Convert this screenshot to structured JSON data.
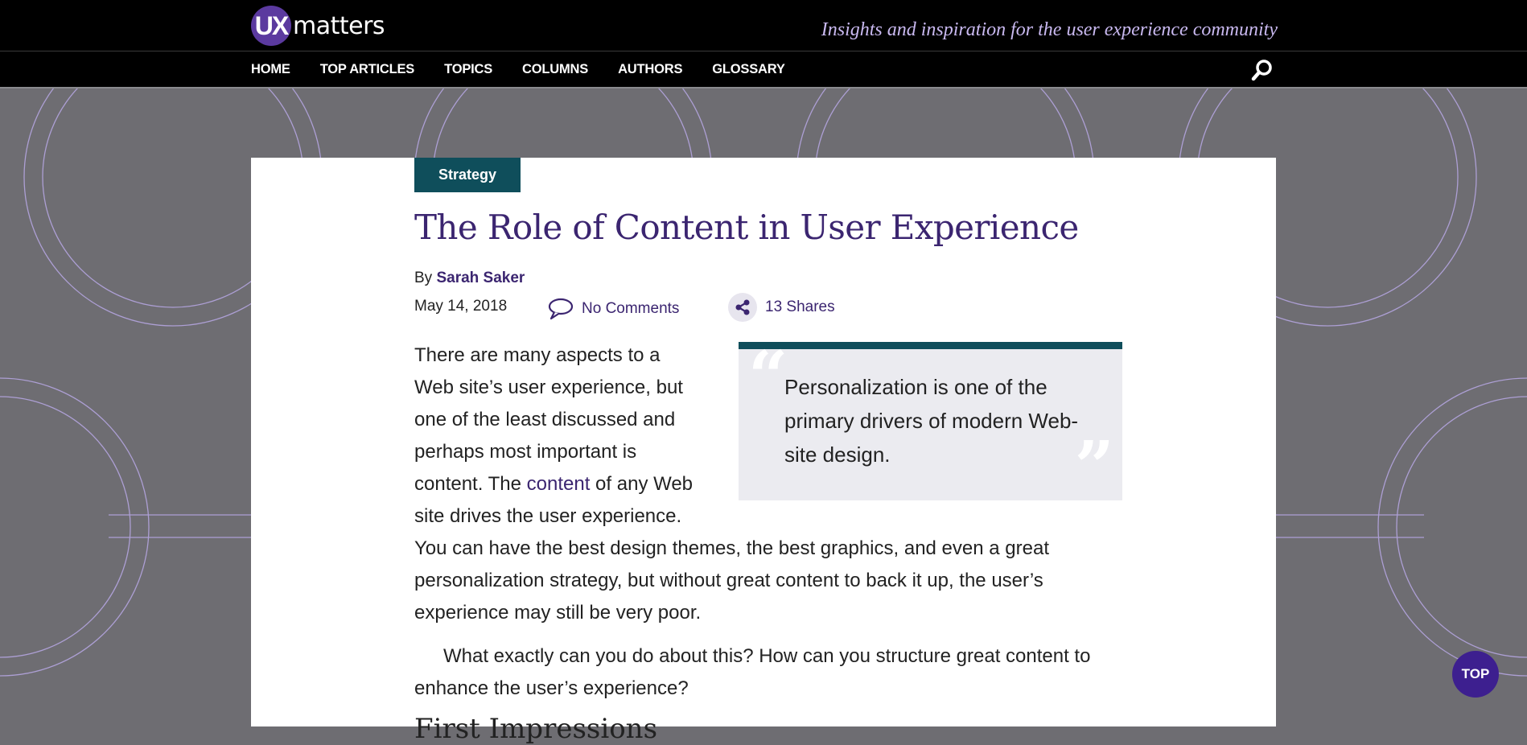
{
  "brand": {
    "logo_mark": "UX",
    "logo_word": "matters",
    "tagline": "Insights and inspiration for the user experience community",
    "accent_color": "#5b3a9f",
    "teal_color": "#0f4e5b",
    "title_color": "#3b2570"
  },
  "nav": {
    "items": [
      "HOME",
      "TOP ARTICLES",
      "TOPICS",
      "COLUMNS",
      "AUTHORS",
      "GLOSSARY"
    ],
    "search_icon": "search-icon"
  },
  "article": {
    "category": "Strategy",
    "title": "The Role of Content in User Experience",
    "by_label": "By",
    "author": "Sarah Saker",
    "date": "May 14, 2018",
    "comments": "No Comments",
    "shares": "13 Shares",
    "pullquote": "Personalization is one of the primary drivers of modern Web-site design.",
    "p1_before_link": "There are many aspects to a Web site’s user experience, but one of the least discussed and perhaps most important is content. The ",
    "p1_link": "content",
    "p1_after_link": " of any Web site drives the user experience. You can have the best design themes, the best graphics, and even a great personalization strategy, but without great content to back it up, the user’s experience may still be very poor.",
    "p2": "What exactly can you do about this? How can you structure great content to enhance the user’s experience?",
    "subhead": "First Impressions"
  },
  "top_button": "TOP"
}
